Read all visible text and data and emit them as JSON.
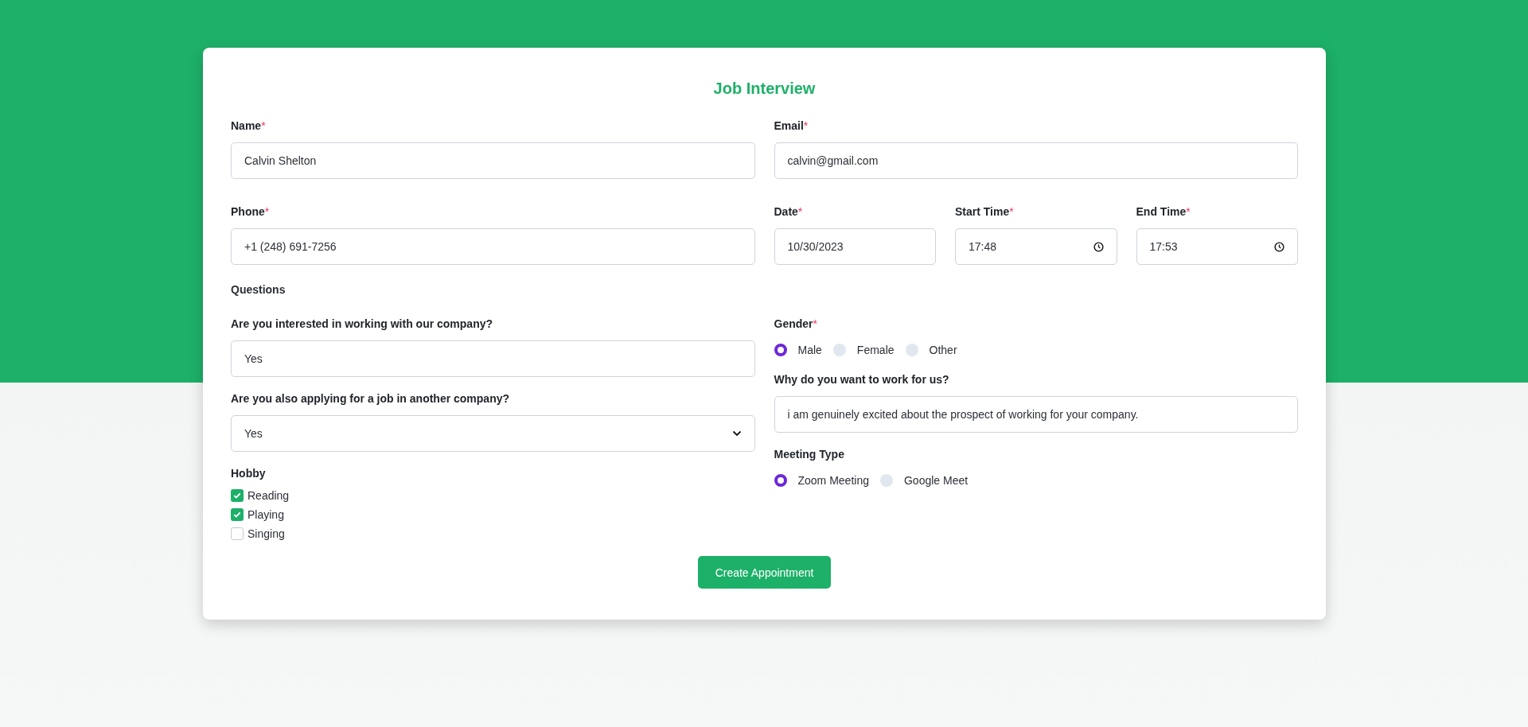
{
  "title": "Job Interview",
  "required_mark": "*",
  "contact": [
    {
      "label": "Name",
      "required": true,
      "value": "Calvin Shelton"
    },
    {
      "label": "Email",
      "required": true,
      "value": "calvin@gmail.com"
    }
  ],
  "phone": {
    "label": "Phone",
    "required": true,
    "value": "+1 (248) 691-7256"
  },
  "schedule": [
    {
      "kind": "date",
      "label": "Date",
      "required": true,
      "value": "10/30/2023"
    },
    {
      "kind": "time",
      "label": "Start Time",
      "required": true,
      "value": "17:48"
    },
    {
      "kind": "time",
      "label": "End Time",
      "required": true,
      "value": "17:53"
    }
  ],
  "questions_heading": "Questions",
  "left_questions": [
    {
      "kind": "text",
      "label": "Are you interested in working with our company?",
      "required": false,
      "value": "Yes"
    },
    {
      "kind": "select",
      "label": "Are you also applying for a job in another company?",
      "required": false,
      "value": "Yes"
    },
    {
      "kind": "checkboxes",
      "label": "Hobby",
      "required": false,
      "options": [
        {
          "label": "Reading",
          "checked": true
        },
        {
          "label": "Playing",
          "checked": true
        },
        {
          "label": "Singing",
          "checked": false
        }
      ]
    }
  ],
  "right_questions": [
    {
      "kind": "radios",
      "label": "Gender",
      "required": true,
      "options": [
        {
          "label": "Male",
          "selected": true
        },
        {
          "label": "Female",
          "selected": false
        },
        {
          "label": "Other",
          "selected": false
        }
      ]
    },
    {
      "kind": "text",
      "label": "Why do you want to work for us?",
      "required": false,
      "value": "i am genuinely excited about the prospect of working for your company."
    },
    {
      "kind": "radios",
      "label": "Meeting Type",
      "required": false,
      "options": [
        {
          "label": "Zoom Meeting",
          "selected": true
        },
        {
          "label": "Google Meet",
          "selected": false
        }
      ]
    }
  ],
  "submit": "Create Appointment"
}
